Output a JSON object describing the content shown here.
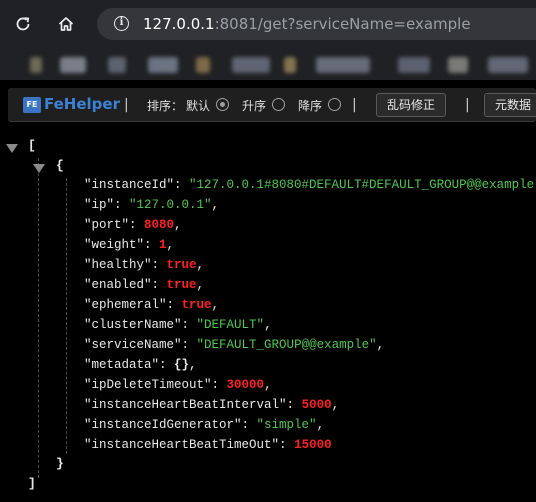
{
  "browser": {
    "url_host": "127.0.0.1",
    "url_rest": ":8081/get?serviceName=example"
  },
  "toolbar": {
    "logo_text": "FeHelper",
    "logo_badge": "FE",
    "separator": "|",
    "sort_label": "排序：",
    "sort_default": "默认",
    "sort_asc": "升序",
    "sort_desc": "降序",
    "fix_button": "乱码修正",
    "meta_button": "元数据"
  },
  "json": {
    "open_bracket": "[",
    "close_bracket": "]",
    "open_brace": "{",
    "close_brace": "}",
    "fields": [
      {
        "key": "\"instanceId\"",
        "value": "\"127.0.0.1#8080#DEFAULT#DEFAULT_GROUP@@example\"",
        "type": "string",
        "trail": ","
      },
      {
        "key": "\"ip\"",
        "value": "\"127.0.0.1\"",
        "type": "string",
        "trail": ","
      },
      {
        "key": "\"port\"",
        "value": "8080",
        "type": "number",
        "trail": ","
      },
      {
        "key": "\"weight\"",
        "value": "1",
        "type": "number",
        "trail": ","
      },
      {
        "key": "\"healthy\"",
        "value": "true",
        "type": "bool",
        "trail": ","
      },
      {
        "key": "\"enabled\"",
        "value": "true",
        "type": "bool",
        "trail": ","
      },
      {
        "key": "\"ephemeral\"",
        "value": "true",
        "type": "bool",
        "trail": ","
      },
      {
        "key": "\"clusterName\"",
        "value": "\"DEFAULT\"",
        "type": "string",
        "trail": ","
      },
      {
        "key": "\"serviceName\"",
        "value": "\"DEFAULT_GROUP@@example\"",
        "type": "string",
        "trail": ","
      },
      {
        "key": "\"metadata\"",
        "value": "{}",
        "type": "object",
        "trail": ","
      },
      {
        "key": "\"ipDeleteTimeout\"",
        "value": "30000",
        "type": "number",
        "trail": ","
      },
      {
        "key": "\"instanceHeartBeatInterval\"",
        "value": "5000",
        "type": "number",
        "trail": ","
      },
      {
        "key": "\"instanceIdGenerator\"",
        "value": "\"simple\"",
        "type": "string",
        "trail": ","
      },
      {
        "key": "\"instanceHeartBeatTimeOut\"",
        "value": "15000",
        "type": "number",
        "trail": ""
      }
    ]
  }
}
